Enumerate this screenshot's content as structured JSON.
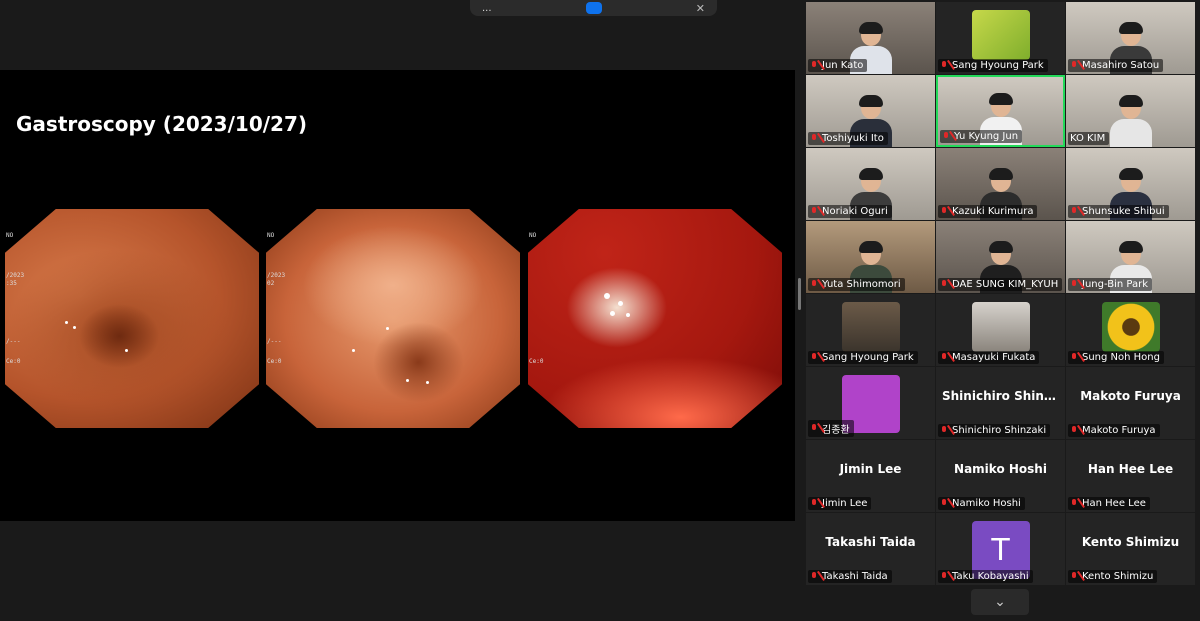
{
  "banner": {
    "text": "...",
    "button_label": "",
    "close": "✕"
  },
  "share": {
    "title": "Gastroscopy (2023/10/27)",
    "overlay_left": [
      "NO",
      "/2023",
      ":35",
      "/---",
      "Ce:0"
    ],
    "overlay_mid": [
      "NO",
      "/2023",
      "02",
      "/---",
      "Ce:0"
    ],
    "overlay_right": [
      "NO",
      "Ce:0"
    ]
  },
  "participants": [
    {
      "name": "Jun Kato",
      "kind": "video"
    },
    {
      "name": "Sang Hyoung Park",
      "kind": "image"
    },
    {
      "name": "Masahiro Satou",
      "kind": "video"
    },
    {
      "name": "Toshiyuki Ito",
      "kind": "video"
    },
    {
      "name": "Yu Kyung Jun",
      "kind": "video",
      "active": true
    },
    {
      "name": "KO KIM",
      "kind": "video"
    },
    {
      "name": "Noriaki Oguri",
      "kind": "video"
    },
    {
      "name": "Kazuki Kurimura",
      "kind": "video"
    },
    {
      "name": "Shunsuke Shibui",
      "kind": "video"
    },
    {
      "name": "Yuta Shimomori",
      "kind": "video"
    },
    {
      "name": "DAE SUNG KIM_KYUH",
      "kind": "video"
    },
    {
      "name": "Jung-Bin Park",
      "kind": "video"
    },
    {
      "name": "Sang Hyoung Park",
      "kind": "video"
    },
    {
      "name": "Masayuki Fukata",
      "kind": "image"
    },
    {
      "name": "Sung Noh Hong",
      "kind": "image"
    },
    {
      "name": "김종환",
      "kind": "color"
    },
    {
      "name": "Shinichiro Shinzaki",
      "display": "Shinichiro  Shinz...",
      "kind": "text"
    },
    {
      "name": "Makoto Furuya",
      "display": "Makoto Furuya",
      "kind": "text"
    },
    {
      "name": "Jimin Lee",
      "display": "Jimin Lee",
      "kind": "text"
    },
    {
      "name": "Namiko Hoshi",
      "display": "Namiko Hoshi",
      "kind": "text"
    },
    {
      "name": "Han Hee Lee",
      "display": "Han Hee Lee",
      "kind": "text"
    },
    {
      "name": "Takashi Taida",
      "display": "Takashi Taida",
      "kind": "text"
    },
    {
      "name": "Taku Kobayashi",
      "kind": "letter",
      "letter": "T"
    },
    {
      "name": "Kento Shimizu",
      "display": "Kento Shimizu",
      "kind": "text"
    }
  ],
  "gallery_next": "⌄",
  "colors": {
    "active_border": "#23d959",
    "muted_mic": "#e02828",
    "accent_button": "#0e72ed",
    "avatar_purple": "#7a4bc2",
    "avatar_magenta": "#b043c9"
  }
}
